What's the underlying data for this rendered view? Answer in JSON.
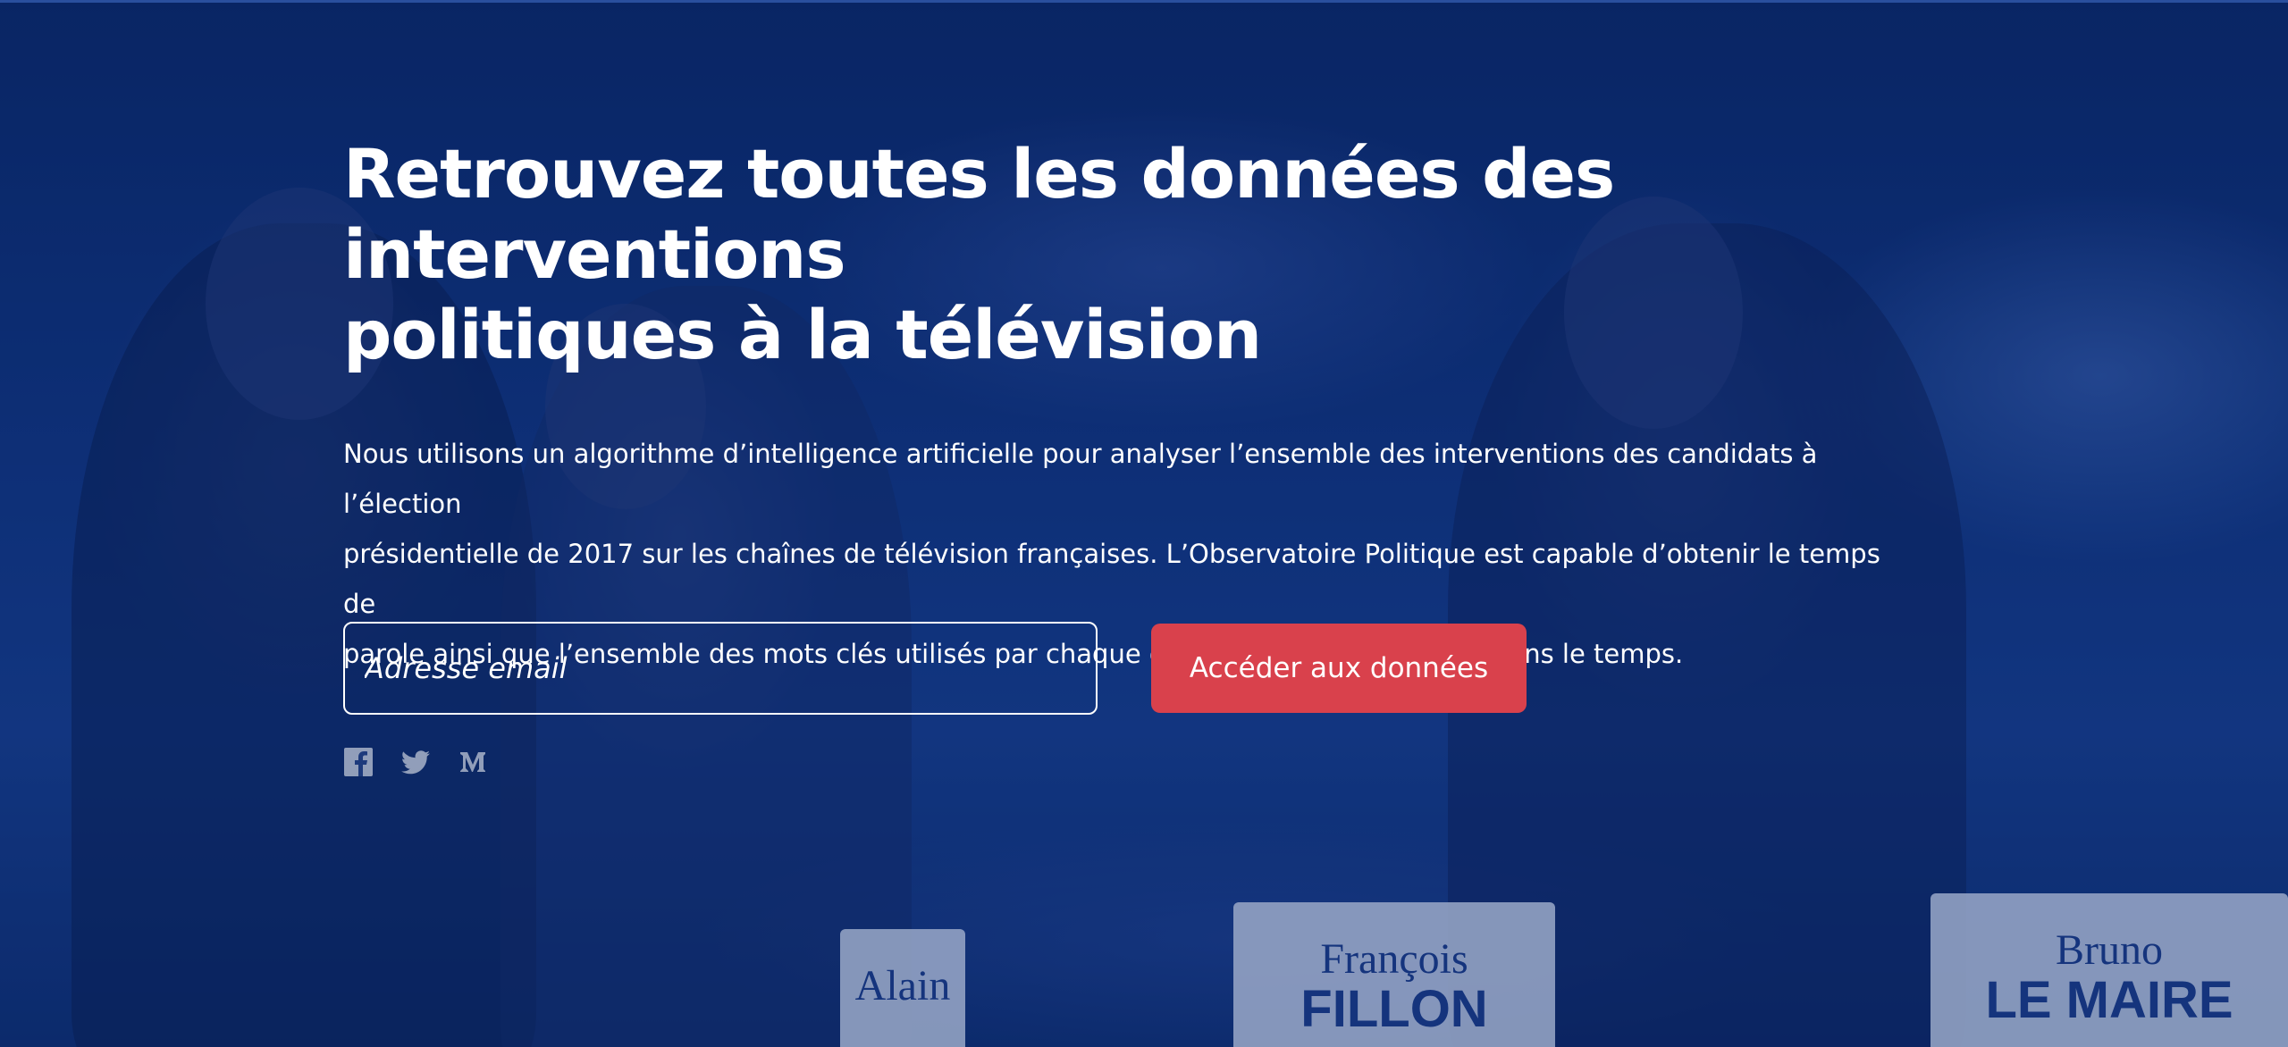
{
  "hero": {
    "headline": "Retrouvez toutes les données des interventions\npolitiques à la télévision",
    "lead": "Nous utilisons un algorithme d’intelligence artificielle pour analyser l’ensemble des interventions des candidats à l’élection\nprésidentielle de 2017 sur les chaînes de télévision françaises. L’Observatoire Politique est capable d’obtenir le temps de\nparole ainsi que l’ensemble des mots clés utilisés par chaque candidat et leur évolution dans le temps."
  },
  "signup": {
    "email_placeholder": "Adresse email",
    "email_value": "",
    "submit_label": "Accéder aux données"
  },
  "social": {
    "icons": [
      "facebook-icon",
      "twitter-icon",
      "medium-icon"
    ]
  },
  "background_cards": {
    "card1_name": "Alain",
    "card2_name": "François",
    "card2_surname": "FILLON",
    "card3_name": "Bruno",
    "card3_surname": "LE MAIRE"
  },
  "colors": {
    "overlay_blue": "#0b2a66",
    "cta_red": "#d9414c",
    "text": "#ffffff"
  }
}
